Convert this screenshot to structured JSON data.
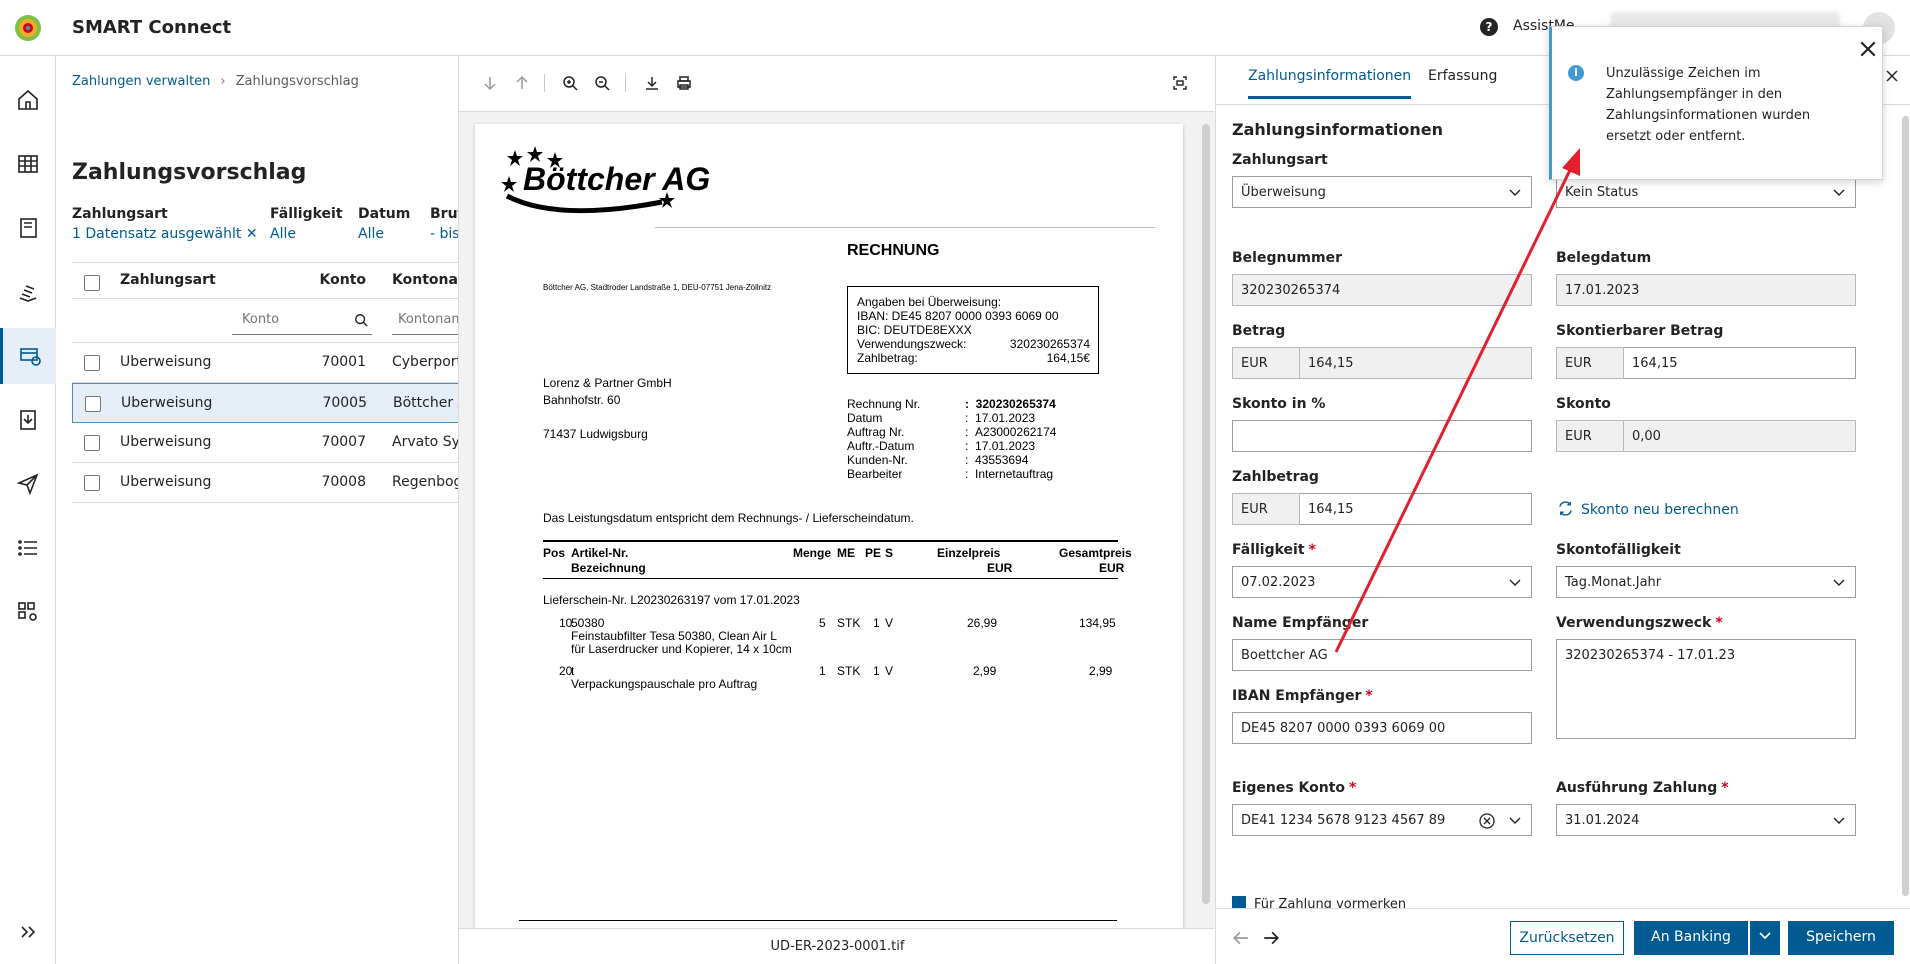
{
  "app": {
    "title": "SMART Connect",
    "assist_label": "AssistMe"
  },
  "breadcrumb": {
    "parent": "Zahlungen verwalten",
    "current": "Zahlungsvorschlag"
  },
  "list": {
    "title": "Zahlungsvorschlag",
    "filters": [
      {
        "label": "Zahlungsart",
        "value": "1 Datensatz ausgewählt ✕"
      },
      {
        "label": "Fälligkeit",
        "value": "Alle"
      },
      {
        "label": "Datum",
        "value": "Alle"
      },
      {
        "label": "Brut",
        "value": "- bis"
      }
    ],
    "columns": [
      "Zahlungsart",
      "Konto",
      "Kontonam"
    ],
    "filter_placeholders": {
      "konto": "Konto",
      "kontoname": "Kontonam"
    },
    "rows": [
      {
        "art": "Überweisung",
        "konto": "70001",
        "name": "Cyberport"
      },
      {
        "art": "Überweisung",
        "konto": "70005",
        "name": "Böttcher A"
      },
      {
        "art": "Überweisung",
        "konto": "70007",
        "name": "Arvato Sys"
      },
      {
        "art": "Überweisung",
        "konto": "70008",
        "name": "Regenboge"
      }
    ]
  },
  "document": {
    "filename": "UD-ER-2023-0001.tif",
    "company_logo_text": "Böttcher AG",
    "heading": "RECHNUNG",
    "sender_line": "Böttcher AG, Stadtroder Landstraße 1, DEU-07751 Jena-Zöllnitz",
    "recipient": [
      "Lorenz & Partner GmbH",
      "Bahnhofstr. 60",
      "",
      "71437 Ludwigsburg"
    ],
    "payment_box": {
      "title": "Angaben bei Überweisung:",
      "iban": "IBAN: DE45 8207 0000 0393 6069 00",
      "bic": "BIC: DEUTDE8EXXX",
      "zweck_label": "Verwendungszweck:",
      "zweck_value": "320230265374",
      "betrag_label": "Zahlbetrag:",
      "betrag_value": "164,15€"
    },
    "meta": [
      {
        "label": "Rechnung Nr.",
        "value": "320230265374"
      },
      {
        "label": "Datum",
        "value": "17.01.2023"
      },
      {
        "label": "Auftrag Nr.",
        "value": "A23000262174"
      },
      {
        "label": "Auftr.-Datum",
        "value": "17.01.2023"
      },
      {
        "label": "Kunden-Nr.",
        "value": "43553694"
      },
      {
        "label": "Bearbeiter",
        "value": "Internetauftrag"
      }
    ],
    "leistungsdatum_note": "Das Leistungsdatum entspricht dem Rechnungs- / Lieferscheindatum.",
    "table_head": {
      "pos": "Pos",
      "artikel": "Artikel-Nr.",
      "bezeichnung": "Bezeichnung",
      "menge": "Menge",
      "me": "ME",
      "pe": "PE",
      "s": "S",
      "einzel": "Einzelpreis",
      "gesamt": "Gesamtpreis",
      "eur": "EUR"
    },
    "lieferschein": "Lieferschein-Nr. L20230263197 vom 17.01.2023",
    "items": [
      {
        "pos": "10",
        "artikel": "50380",
        "desc1": "Feinstaubfilter Tesa 50380, Clean Air L",
        "desc2": "für Laserdrucker und Kopierer, 14 x 10cm",
        "menge": "5",
        "me": "STK",
        "pe": "1",
        "s": "V",
        "einzel": "26,99",
        "gesamt": "134,95"
      },
      {
        "pos": "20",
        "artikel": "t",
        "desc1": "Verpackungspauschale pro Auftrag",
        "desc2": "",
        "menge": "1",
        "me": "STK",
        "pe": "1",
        "s": "V",
        "einzel": "2,99",
        "gesamt": "2,99"
      }
    ]
  },
  "detail": {
    "tabs": [
      "Zahlungsinformationen",
      "Erfassung"
    ],
    "section_title": "Zahlungsinformationen",
    "fields": {
      "zahlungsart": {
        "label": "Zahlungsart",
        "value": "Überweisung"
      },
      "status": {
        "value": "Kein Status"
      },
      "belegnummer": {
        "label": "Belegnummer",
        "value": "320230265374"
      },
      "belegdatum": {
        "label": "Belegdatum",
        "value": "17.01.2023"
      },
      "betrag": {
        "label": "Betrag",
        "currency": "EUR",
        "value": "164,15"
      },
      "skontierbar": {
        "label": "Skontierbarer Betrag",
        "currency": "EUR",
        "value": "164,15"
      },
      "skonto_pct": {
        "label": "Skonto in %",
        "value": ""
      },
      "skonto": {
        "label": "Skonto",
        "currency": "EUR",
        "value": "0,00"
      },
      "zahlbetrag": {
        "label": "Zahlbetrag",
        "currency": "EUR",
        "value": "164,15"
      },
      "skonto_neu": "Skonto neu berechnen",
      "faelligkeit": {
        "label": "Fälligkeit",
        "value": "07.02.2023"
      },
      "skontofaelligkeit": {
        "label": "Skontofälligkeit",
        "value": "Tag.Monat.Jahr"
      },
      "name_empf": {
        "label": "Name Empfänger",
        "value": "Boettcher AG"
      },
      "verwendungszweck": {
        "label": "Verwendungszweck",
        "value": "320230265374 - 17.01.23"
      },
      "iban_empf": {
        "label": "IBAN Empfänger",
        "value": "DE45 8207 0000 0393 6069 00"
      },
      "eigenes_konto": {
        "label": "Eigenes Konto",
        "value": "DE41 1234 5678 9123 4567 89"
      },
      "ausfuehrung": {
        "label": "Ausführung Zahlung",
        "value": "31.01.2024"
      },
      "vormerken": "Für Zahlung vormerken"
    },
    "buttons": {
      "reset": "Zurücksetzen",
      "banking": "An Banking",
      "save": "Speichern"
    }
  },
  "toast": {
    "message": "Unzulässige Zeichen im Zahlungsempfänger in den Zahlungsinformationen wurden ersetzt oder entfernt."
  },
  "colors": {
    "accent": "#005b92",
    "required": "#d0021b",
    "info": "#409bd2",
    "annotation_arrow": "#e0202e"
  }
}
